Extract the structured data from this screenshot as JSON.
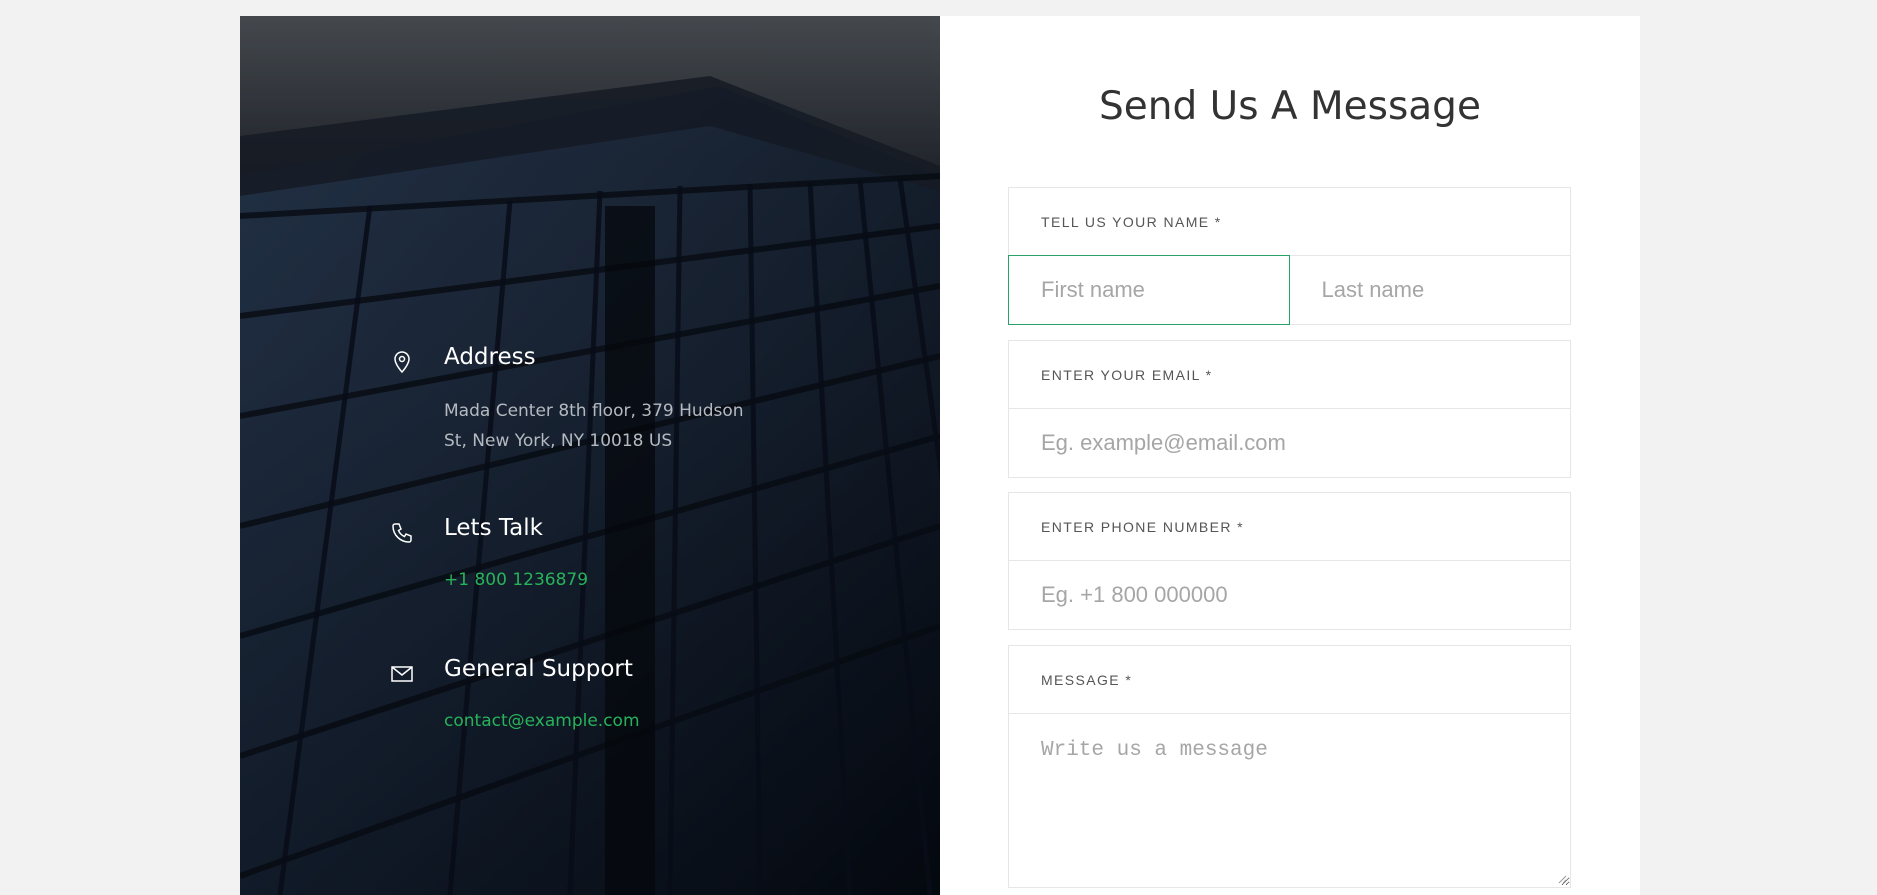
{
  "contact_info": {
    "address": {
      "icon": "map-pin-icon",
      "title": "Address",
      "line1": "Mada Center 8th floor, 379 Hudson",
      "line2": "St, New York, NY 10018 US"
    },
    "talk": {
      "icon": "phone-icon",
      "title": "Lets Talk",
      "phone": "+1 800 1236879"
    },
    "support": {
      "icon": "mail-icon",
      "title": "General Support",
      "email": "contact@example.com"
    },
    "accent_color": "#27b35a"
  },
  "form": {
    "heading": "Send Us A Message",
    "name": {
      "label": "TELL US YOUR NAME *",
      "first_placeholder": "First name",
      "last_placeholder": "Last name",
      "first_value": "",
      "last_value": ""
    },
    "email": {
      "label": "ENTER YOUR EMAIL *",
      "placeholder": "Eg. example@email.com",
      "value": ""
    },
    "phone": {
      "label": "ENTER PHONE NUMBER *",
      "placeholder": "Eg. +1 800 000000",
      "value": ""
    },
    "message": {
      "label": "MESSAGE *",
      "placeholder": "Write us a message",
      "value": ""
    },
    "focus_color": "#27a36a"
  }
}
